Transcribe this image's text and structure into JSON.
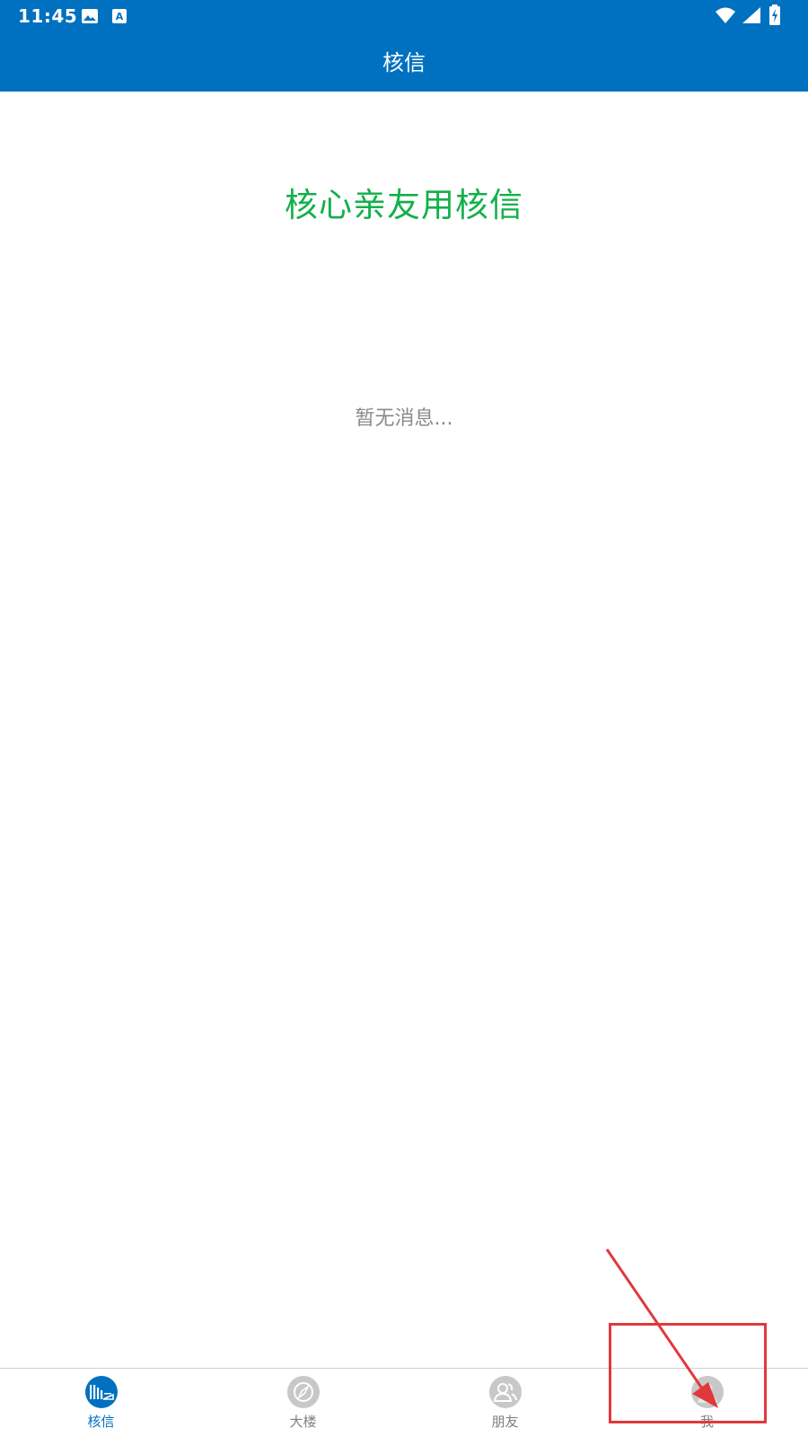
{
  "status_bar": {
    "time": "11:45",
    "icons": [
      "image-icon",
      "text-a-icon",
      "wifi-icon",
      "signal-icon",
      "battery-charging-icon"
    ]
  },
  "header": {
    "title": "核信",
    "bg_color": "#0070C0"
  },
  "main": {
    "tagline": "核心亲友用核信",
    "tagline_color": "#12B04A",
    "empty_message": "暂无消息..."
  },
  "bottom_nav": {
    "items": [
      {
        "label": "核信",
        "icon": "hexin-logo-icon",
        "active": true
      },
      {
        "label": "大楼",
        "icon": "compass-icon",
        "active": false
      },
      {
        "label": "朋友",
        "icon": "friends-icon",
        "active": false
      },
      {
        "label": "我",
        "icon": "profile-icon",
        "active": false
      }
    ],
    "active_color": "#0070C0",
    "inactive_color": "#808080"
  },
  "annotation": {
    "box_color": "#E0393C",
    "target": "我"
  }
}
